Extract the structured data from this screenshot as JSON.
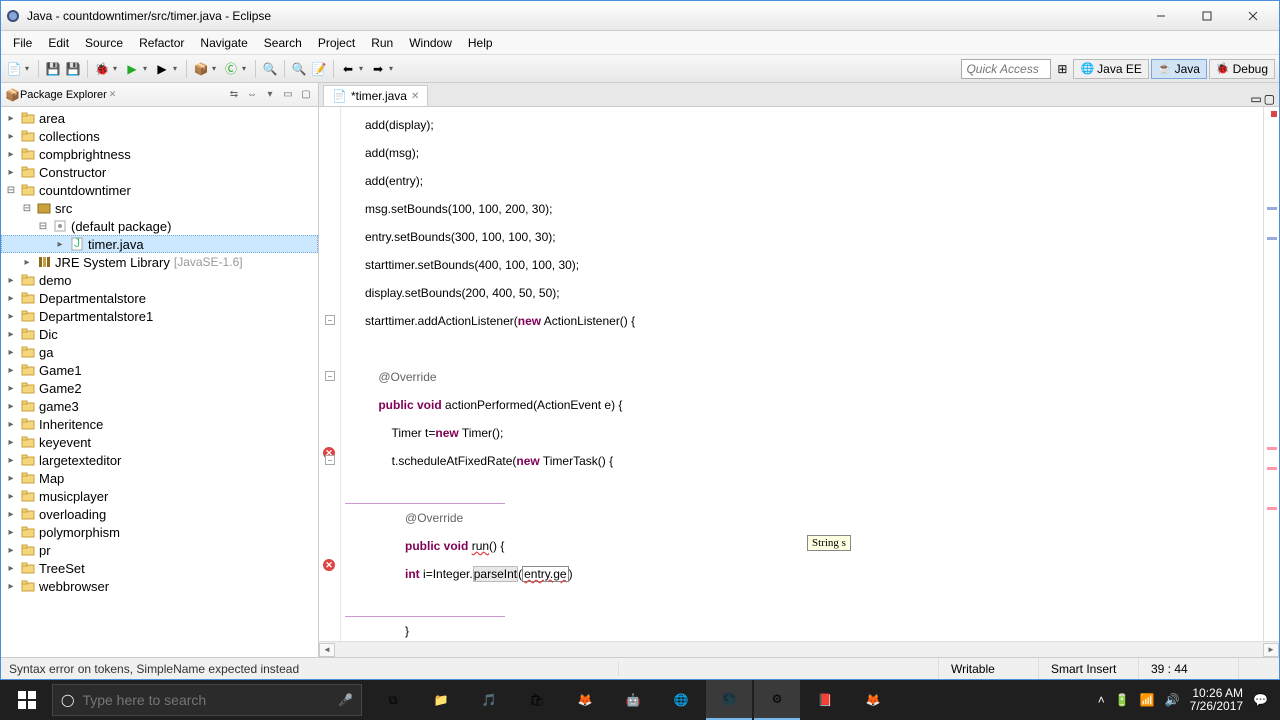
{
  "window": {
    "title": "Java - countdowntimer/src/timer.java - Eclipse"
  },
  "menu": [
    "File",
    "Edit",
    "Source",
    "Refactor",
    "Navigate",
    "Search",
    "Project",
    "Run",
    "Window",
    "Help"
  ],
  "quick_access_placeholder": "Quick Access",
  "perspectives": {
    "javaee": "Java EE",
    "java": "Java",
    "debug": "Debug"
  },
  "package_explorer": {
    "title": "Package Explorer",
    "projects": [
      {
        "name": "area",
        "exp": false
      },
      {
        "name": "collections",
        "exp": false
      },
      {
        "name": "compbrightness",
        "exp": false
      },
      {
        "name": "Constructor",
        "exp": false
      },
      {
        "name": "countdowntimer",
        "exp": true,
        "children": [
          {
            "name": "src",
            "exp": true,
            "children": [
              {
                "name": "(default package)",
                "exp": true,
                "children": [
                  {
                    "name": "timer.java",
                    "selected": true
                  }
                ]
              }
            ]
          },
          {
            "name": "JRE System Library",
            "lib": "[JavaSE-1.6]"
          }
        ]
      },
      {
        "name": "demo",
        "exp": false
      },
      {
        "name": "Departmentalstore",
        "exp": false
      },
      {
        "name": "Departmentalstore1",
        "exp": false
      },
      {
        "name": "Dic",
        "exp": false
      },
      {
        "name": "ga",
        "exp": false
      },
      {
        "name": "Game1",
        "exp": false
      },
      {
        "name": "Game2",
        "exp": false
      },
      {
        "name": "game3",
        "exp": false
      },
      {
        "name": "Inheritence",
        "exp": false
      },
      {
        "name": "keyevent",
        "exp": false
      },
      {
        "name": "largetexteditor",
        "exp": false
      },
      {
        "name": "Map",
        "exp": false
      },
      {
        "name": "musicplayer",
        "exp": false
      },
      {
        "name": "overloading",
        "exp": false
      },
      {
        "name": "polymorphism",
        "exp": false
      },
      {
        "name": "pr",
        "exp": false
      },
      {
        "name": "TreeSet",
        "exp": false
      },
      {
        "name": "webbrowser",
        "exp": false
      }
    ]
  },
  "editor": {
    "tab": "*timer.java",
    "tooltip": "String s",
    "code_lines": [
      {
        "t": "      add(display);"
      },
      {
        "t": "      add(msg);"
      },
      {
        "t": "      add(entry);"
      },
      {
        "t": "      msg.setBounds(100, 100, 200, 30);"
      },
      {
        "t": "      entry.setBounds(300, 100, 100, 30);"
      },
      {
        "t": "      starttimer.setBounds(400, 100, 100, 30);"
      },
      {
        "t": "      display.setBounds(200, 400, 50, 50);"
      },
      {
        "t": "      starttimer.addActionListener(",
        "kw": "new",
        "t2": " ActionListener() {"
      },
      {
        "t": ""
      },
      {
        "ann": "          @Override"
      },
      {
        "t": "          ",
        "kw": "public void",
        "t2": " actionPerformed(ActionEvent e) {"
      },
      {
        "t": "              Timer t=",
        "kw": "new",
        "t2": " Timer();"
      },
      {
        "err": true,
        "t": "              t.scheduleAtFixedRate(",
        "kw": "new",
        "t2": " TimerTask() {"
      },
      {
        "ul": true,
        "t": "                  "
      },
      {
        "ann": "                  @Override"
      },
      {
        "t": "                  ",
        "kw": "public void",
        "t2": " ",
        "run": "run",
        "t3": "() {"
      },
      {
        "err": true,
        "parseint": true
      },
      {
        "ul": true,
        "t": "                            "
      },
      {
        "t": "                  }"
      }
    ]
  },
  "status": {
    "msg": "Syntax error on tokens, SimpleName expected instead",
    "writable": "Writable",
    "insert": "Smart Insert",
    "pos": "39 : 44"
  },
  "taskbar": {
    "search_placeholder": "Type here to search",
    "time": "10:26 AM",
    "date": "7/26/2017"
  }
}
